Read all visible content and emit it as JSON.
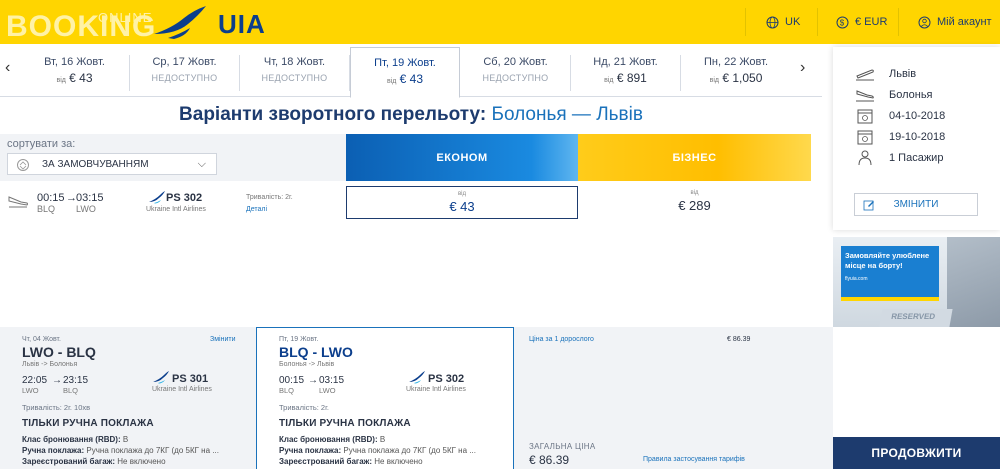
{
  "header": {
    "booking": "BOOKING",
    "online": "ONLINE",
    "brand": "UIA",
    "language": "UK",
    "currency": "€ EUR",
    "account": "Мій акаунт"
  },
  "dates": [
    {
      "day": "Вт, 16 Жовт.",
      "from": "від",
      "price": "€ 43",
      "available": true
    },
    {
      "day": "Ср, 17 Жовт.",
      "status": "НЕДОСТУПНО",
      "available": false
    },
    {
      "day": "Чт, 18 Жовт.",
      "status": "НЕДОСТУПНО",
      "available": false
    },
    {
      "day": "Пт, 19 Жовт.",
      "from": "від",
      "price": "€ 43",
      "available": true
    },
    {
      "day": "Сб, 20 Жовт.",
      "status": "НЕДОСТУПНО",
      "available": false
    },
    {
      "day": "Нд, 21 Жовт.",
      "from": "від",
      "price": "€ 891",
      "available": true
    },
    {
      "day": "Пн, 22 Жовт.",
      "from": "від",
      "price": "€ 1,050",
      "available": true
    }
  ],
  "title": {
    "prefix": "Варіанти зворотного перельоту:",
    "route": "Болонья — Львів"
  },
  "sort": {
    "label": "сортувати за:",
    "value": "ЗА ЗАМОВЧУВАННЯМ"
  },
  "fares": {
    "econom": "ЕКОНОМ",
    "business": "БІЗНЕС"
  },
  "flight": {
    "dep_time": "00:15",
    "arr_time": "03:15",
    "dep_code": "BLQ",
    "arr_code": "LWO",
    "number": "PS 302",
    "airline": "Ukraine Intl Airlines",
    "duration": "Тривалість: 2г.",
    "details": "Деталі",
    "econ_from": "від",
    "econ_price": "€ 43",
    "biz_from": "від",
    "biz_price": "€ 289"
  },
  "summary": {
    "from": "Львів",
    "to": "Болонья",
    "depart": "04-10-2018",
    "return": "19-10-2018",
    "passengers": "1 Пасажир",
    "change": "ЗМІНИТИ"
  },
  "ad": {
    "text": "Замовляйте улюблене місце на борту!",
    "url": "flyuia.com",
    "sign": "RESERVED"
  },
  "outbound": {
    "date": "Чт, 04 Жовт.",
    "change": "Змінити",
    "route": "LWO - BLQ",
    "sub": "Львів -> Болонья",
    "dep_time": "22:05",
    "arr_time": "23:15",
    "dep_code": "LWO",
    "arr_code": "BLQ",
    "number": "PS 301",
    "airline": "Ukraine Intl Airlines",
    "duration": "Тривалість: 2г. 10хв",
    "bag_title": "ТІЛЬКИ РУЧНА ПОКЛАЖА",
    "rbd_label": "Клас бронювання (RBD):",
    "rbd_val": "B",
    "hand_label": "Ручна поклажа:",
    "hand_val": "Ручна поклажа до 7КГ (до 5КГ на ...",
    "checked_label": "Зареєстрований багаж:",
    "checked_val": "Не включено"
  },
  "inbound": {
    "date": "Пт, 19 Жовт.",
    "route": "BLQ - LWO",
    "sub": "Болонья -> Львів",
    "dep_time": "00:15",
    "arr_time": "03:15",
    "dep_code": "BLQ",
    "arr_code": "LWO",
    "number": "PS 302",
    "airline": "Ukraine Intl Airlines",
    "duration": "Тривалість: 2г.",
    "bag_title": "ТІЛЬКИ РУЧНА ПОКЛАЖА",
    "rbd_label": "Клас бронювання (RBD):",
    "rbd_val": "B",
    "hand_label": "Ручна поклажа:",
    "hand_val": "Ручна поклажа до 7КГ (до 5КГ на ...",
    "checked_label": "Зареєстрований багаж:",
    "checked_val": "Не включено"
  },
  "pricing": {
    "per_adult_label": "Ціна за 1 дорослого",
    "per_adult": "€ 86.39",
    "total_label": "ЗАГАЛЬНА ЦІНА",
    "total": "€ 86.39",
    "rules": "Правила застосування тарифів"
  },
  "continue": "ПРОДОВЖИТИ",
  "colors": {
    "brand_yellow": "#ffd500",
    "brand_navy": "#1d3b6e",
    "link_blue": "#1a72bb"
  }
}
